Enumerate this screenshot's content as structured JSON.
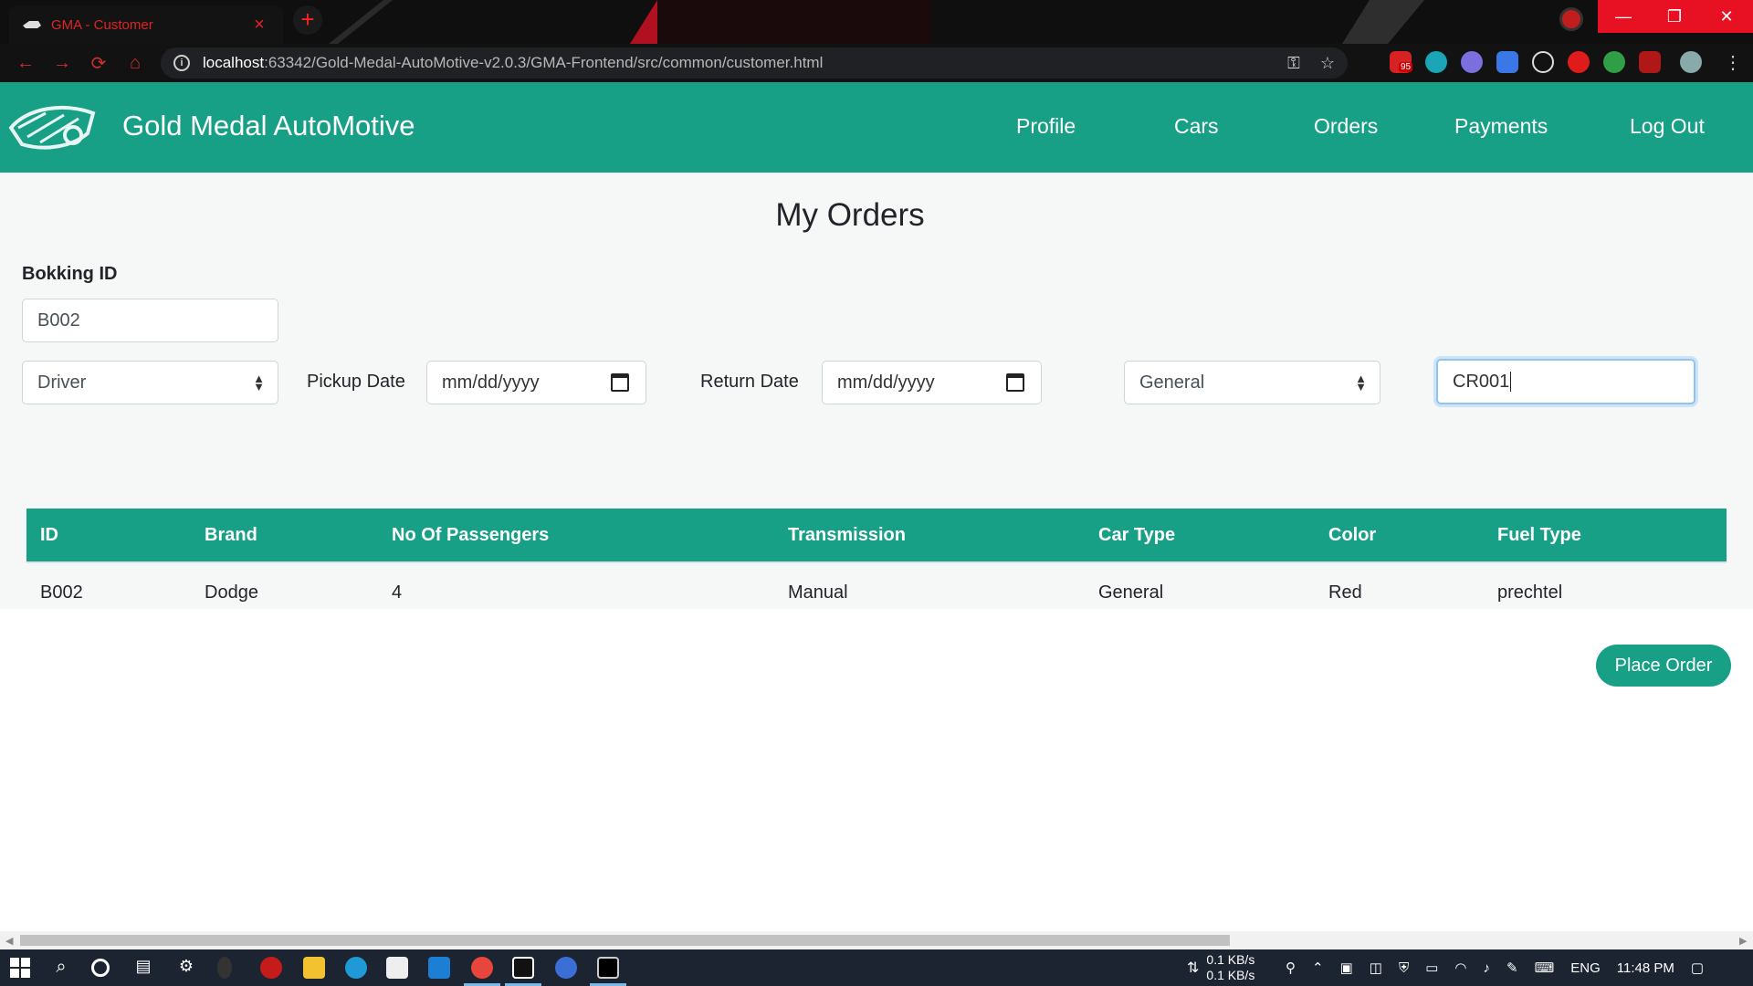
{
  "browser": {
    "tab_title": "GMA - Customer",
    "url_host": "localhost",
    "url_path": ":63342/Gold-Medal-AutoMotive-v2.0.3/GMA-Frontend/src/common/customer.html",
    "gmail_badge": "95"
  },
  "nav": {
    "brand": "Gold Medal AutoMotive",
    "links": [
      "Profile",
      "Cars",
      "Orders",
      "Payments",
      "Log Out"
    ]
  },
  "main": {
    "heading": "My Orders",
    "booking_label": "Bokking ID",
    "booking_value": "B002",
    "driver_select": "Driver",
    "pickup_label": "Pickup Date",
    "pickup_value": "mm/dd/yyyy",
    "return_label": "Return Date",
    "return_value": "mm/dd/yyyy",
    "type_select": "General",
    "car_id_value": "CR001",
    "table": {
      "headers": [
        "ID",
        "Brand",
        "No Of Passengers",
        "Transmission",
        "Car Type",
        "Color",
        "Fuel Type"
      ],
      "rows": [
        [
          "B002",
          "Dodge",
          "4",
          "Manual",
          "General",
          "Red",
          "prechtel"
        ]
      ]
    },
    "place_order": "Place Order"
  },
  "taskbar": {
    "net_down": "0.1 KB/s",
    "net_up": "0.1 KB/s",
    "lang": "ENG",
    "time": "11:48 PM"
  },
  "colors": {
    "brand_teal": "#17a086",
    "tab_red": "#e02424"
  }
}
